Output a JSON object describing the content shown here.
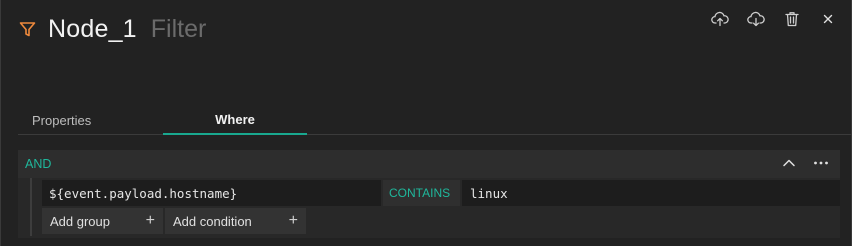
{
  "header": {
    "title": "Node_1",
    "subtitle": "Filter",
    "icon": "filter-icon",
    "accent_color": "#f08a3c"
  },
  "toolbar": {
    "icons": [
      "upload-cloud-icon",
      "download-cloud-icon",
      "trash-icon",
      "close-icon"
    ]
  },
  "tabs": [
    {
      "label": "Properties",
      "active": false
    },
    {
      "label": "Where",
      "active": true
    }
  ],
  "where": {
    "operator": "AND",
    "accent_color": "#1fb89c",
    "conditions": [
      {
        "field": "${event.payload.hostname}",
        "operator": "CONTAINS",
        "value": "linux"
      }
    ],
    "add_group_label": "Add group",
    "add_condition_label": "Add condition",
    "add_symbol": "+"
  }
}
